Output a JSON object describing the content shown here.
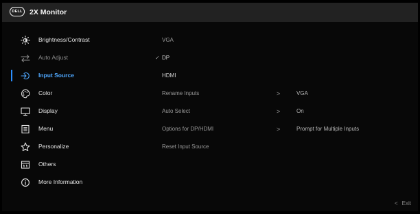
{
  "title_bar": {
    "logo_text": "DELL",
    "title": "2X Monitor"
  },
  "menu": {
    "items": [
      {
        "label": "Brightness/Contrast",
        "icon": "brightness-icon",
        "state": "normal"
      },
      {
        "label": "Auto Adjust",
        "icon": "auto-adjust-icon",
        "state": "dim"
      },
      {
        "label": "Input Source",
        "icon": "input-source-icon",
        "state": "active"
      },
      {
        "label": "Color",
        "icon": "color-icon",
        "state": "normal"
      },
      {
        "label": "Display",
        "icon": "display-icon",
        "state": "normal"
      },
      {
        "label": "Menu",
        "icon": "menu-icon",
        "state": "normal"
      },
      {
        "label": "Personalize",
        "icon": "star-icon",
        "state": "normal"
      },
      {
        "label": "Others",
        "icon": "others-icon",
        "state": "normal"
      },
      {
        "label": "More Information",
        "icon": "info-icon",
        "state": "normal"
      }
    ]
  },
  "input_source": {
    "options": [
      {
        "label": "VGA",
        "selected": false
      },
      {
        "label": "DP",
        "selected": true
      },
      {
        "label": "HDMI",
        "selected": false
      },
      {
        "label": "Rename Inputs",
        "value": "VGA"
      },
      {
        "label": "Auto Select",
        "value": "On"
      },
      {
        "label": "Options for DP/HDMI",
        "value": "Prompt for Multiple Inputs"
      },
      {
        "label": "Reset Input Source"
      }
    ],
    "check_glyph": "✓",
    "chevron_glyph": ">"
  },
  "footer": {
    "exit_arrow": "<",
    "exit_label": "Exit"
  },
  "colors": {
    "accent": "#2b8fff",
    "active_text": "#4fa8ff",
    "title_bar_bg": "#222222"
  }
}
